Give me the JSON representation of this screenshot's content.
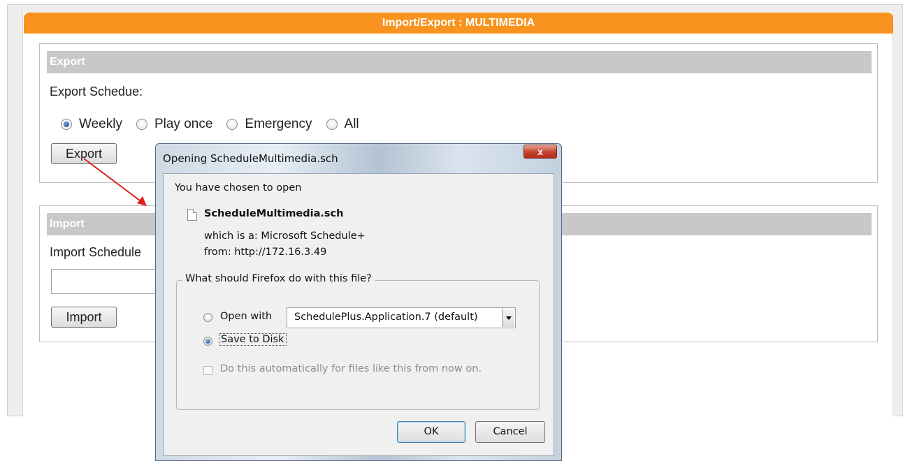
{
  "header": {
    "title": "Import/Export : MULTIMEDIA"
  },
  "export_section": {
    "heading": "Export",
    "schedule_label": "Export Schedue:",
    "options": [
      {
        "label": "Weekly",
        "checked": true
      },
      {
        "label": "Play once",
        "checked": false
      },
      {
        "label": "Emergency",
        "checked": false
      },
      {
        "label": "All",
        "checked": false
      }
    ],
    "button_label": "Export"
  },
  "import_section": {
    "heading": "Import",
    "schedule_label": "Import Schedule",
    "file_value": "",
    "button_label": "Import"
  },
  "dialog": {
    "title": "Opening ScheduleMultimedia.sch",
    "close_label": "x",
    "chosen_text": "You have chosen to open",
    "file_name": "ScheduleMultimedia.sch",
    "which_is": "which is a:  Microsoft Schedule+",
    "from": "from:  http://172.16.3.49",
    "question": "What should Firefox do with this file?",
    "open_with_label": "Open with",
    "open_with_checked": false,
    "application": "SchedulePlus.Application.7 (default)",
    "save_label": "Save to Disk",
    "save_checked": true,
    "auto_label": "Do this automatically for files like this from now on.",
    "ok_label": "OK",
    "cancel_label": "Cancel"
  },
  "colors": {
    "title_bar": "#f7931e",
    "section_header": "#c8c8c8",
    "annotation_arrow": "#e02020"
  }
}
